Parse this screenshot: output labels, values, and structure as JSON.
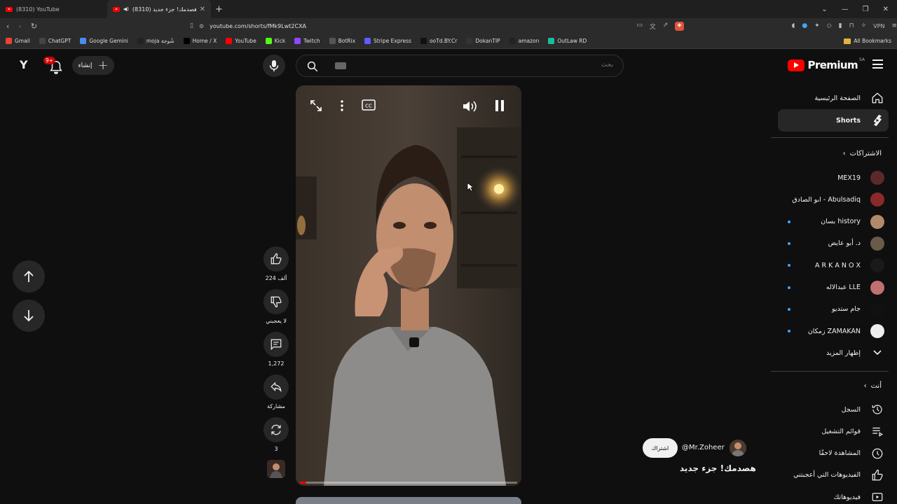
{
  "browser": {
    "tabs": [
      {
        "title": "(8310) YouTube"
      },
      {
        "title": "(8310) هصدمك! جزء جديد"
      }
    ],
    "url": "youtube.com/shorts/fMk9Lwt2CXA",
    "vpn_label": "VPN",
    "bookmarks": [
      {
        "label": "Gmail",
        "color": "#ea4335"
      },
      {
        "label": "ChatGPT",
        "color": "#444"
      },
      {
        "label": "Google Gemini",
        "color": "#4b8bf5"
      },
      {
        "label": "moja شُوجة",
        "color": "#222"
      },
      {
        "label": "Home / X",
        "color": "#000"
      },
      {
        "label": "YouTube",
        "color": "#ff0000"
      },
      {
        "label": "Kick",
        "color": "#53fc18"
      },
      {
        "label": "Twitch",
        "color": "#9146ff"
      },
      {
        "label": "BotRix",
        "color": "#555"
      },
      {
        "label": "Stripe Express",
        "color": "#635bff"
      },
      {
        "label": "ooTd.BY.Cr",
        "color": "#111"
      },
      {
        "label": "DokanTIP",
        "color": "#333"
      },
      {
        "label": "amazon",
        "color": "#222"
      },
      {
        "label": "OutLaw RD",
        "color": "#1abc9c"
      }
    ],
    "all_bookmarks": "All Bookmarks"
  },
  "header": {
    "notifications_badge": "9+",
    "create_label": "إنشاء",
    "search_placeholder": "بحث",
    "logo_text": "Premium",
    "region": "SA"
  },
  "short": {
    "likes": "224 ألف",
    "dislike_label": "لا يعجبني",
    "comments": "1,272",
    "share_label": "مشاركة",
    "remix_count": "3",
    "channel_handle": "@Mr.Zoheer",
    "subscribe_label": "اشتراك",
    "title": "هصدمك! جزء جديد",
    "progress": 0.03
  },
  "sidebar": {
    "home": "الصفحة الرئيسية",
    "shorts": "Shorts",
    "subscriptions_heading": "الاشتراكات",
    "subscriptions": [
      {
        "name": "MEX19",
        "dot": false,
        "color": "#5a2a2a"
      },
      {
        "name": "ابو الصادق - Abulsadiq",
        "dot": false,
        "color": "#8a2a2a"
      },
      {
        "name": "بسان history",
        "dot": true,
        "color": "#b08a6a"
      },
      {
        "name": "د. أبو عايض",
        "dot": true,
        "color": "#6a5a4a"
      },
      {
        "name": "A R K A N O X",
        "dot": true,
        "color": "#1a1a1a"
      },
      {
        "name": "عبدالاله LLE",
        "dot": true,
        "color": "#c07070"
      },
      {
        "name": "جام ستديو",
        "dot": true,
        "color": "#111"
      },
      {
        "name": "زمكان ZAMAKAN",
        "dot": true,
        "color": "#eee"
      }
    ],
    "show_more": "إظهار المزيد",
    "you_heading": "أنت",
    "you_items": [
      {
        "label": "السجل",
        "icon": "history-icon"
      },
      {
        "label": "قوائم التشغيل",
        "icon": "playlists-icon"
      },
      {
        "label": "المشاهدة لاحقًا",
        "icon": "watch-later-icon"
      },
      {
        "label": "الفيديوهات التي أعجبتني",
        "icon": "liked-videos-icon"
      },
      {
        "label": "فيديوهاتك",
        "icon": "your-videos-icon"
      }
    ]
  }
}
